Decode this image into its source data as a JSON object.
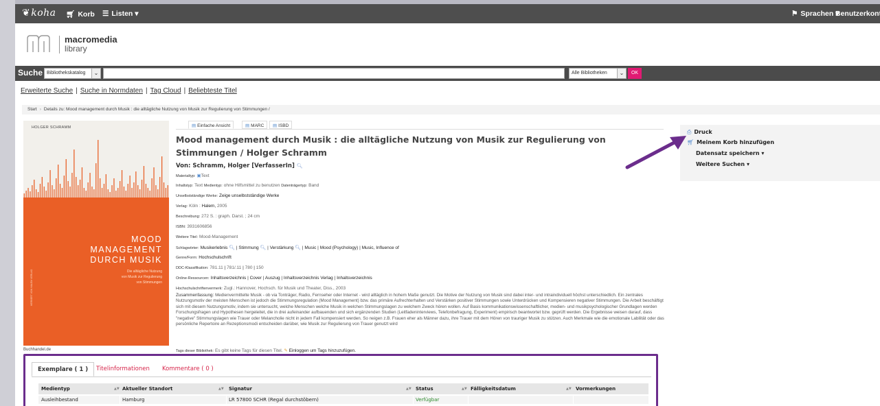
{
  "navbar": {
    "brand": "koha",
    "cart": "Korb",
    "lists": "Listen",
    "languages": "Sprachen",
    "account": "Benutzerkonto"
  },
  "logo": {
    "line1": "macromedia",
    "line2": "library"
  },
  "search": {
    "label": "Suche",
    "scope": "Bibliothekskatalog",
    "library": "Alle Bibliotheken",
    "ok": "OK"
  },
  "sublinks": [
    "Erweiterte Suche",
    "Suche in Normdaten",
    "Tag Cloud",
    "Beliebteste Titel"
  ],
  "breadcrumb": {
    "home": "Start",
    "current": "Details zu: Mood management durch Musik : die alltägliche Nutzung von Musik zur Regulierung von Stimmungen /"
  },
  "cover": {
    "author": "HOLGER SCHRAMM",
    "title_l1": "MOOD",
    "title_l2": "MANAGEMENT",
    "title_l3": "DURCH MUSIK",
    "sub_l1": "Die alltägliche Nutzung",
    "sub_l2": "von Musik zur Regulierung",
    "sub_l3": "von Stimmungen",
    "spine": "HERBERT VON HALEM VERLAG",
    "caption": "Buchhandel.de"
  },
  "viewtabs": [
    "Einfache Ansicht",
    "MARC",
    "ISBD"
  ],
  "record": {
    "title": "Mood management durch Musik : die alltägliche Nutzung von Musik zur Regulierung von Stimmungen / Holger Schramm",
    "author_label": "Von:",
    "author": "Schramm, Holger [VerfasserIn]",
    "material_label": "Materialtyp:",
    "material": "Text",
    "content_label": "Inhaltstyp:",
    "content": "Text",
    "media_label": "Medientyp:",
    "media": "ohne Hilfsmittel zu benutzen",
    "carrier_label": "Datenträgertyp:",
    "carrier": "Band",
    "independent_label": "Unselbstständige Werke:",
    "independent": "Zeige unselbstständige Werke",
    "publisher_label": "Verlag:",
    "publisher_place": "Köln :",
    "publisher": "Halem,",
    "publisher_year": "2005",
    "desc_label": "Beschreibung:",
    "desc": "272 S. : graph. Darst. ; 24 cm",
    "isbn_label": "ISBN:",
    "isbn": "3931606856",
    "other_title_label": "Weitere Titel:",
    "other_title": "Mood-Management",
    "subjects_label": "Schlagwörter:",
    "subjects": [
      "Musikerlebnis",
      "Stimmung",
      "Verstärkung",
      "Music",
      "Mood (Psychology)",
      "Music, Influence of"
    ],
    "genre_label": "Genre/Form:",
    "genre": "Hochschulschrift",
    "ddc_label": "DDC-Klassifikation:",
    "ddc": [
      "781.11",
      "781/.11",
      "780",
      "150"
    ],
    "online_label": "Online-Ressourcen:",
    "online": [
      "Inhaltsverzeichnis",
      "Cover",
      "Auszug",
      "Inhaltsverzeichnis Verlag",
      "Inhaltsverzeichnis"
    ],
    "thesis_label": "Hochschulschriftenvermerk:",
    "thesis": "Zugl.: Hannover, Hochsch. für Musik und Theater, Diss., 2003",
    "summary_label": "Zusammenfassung:",
    "summary": "Medienvermittelte Musik - ob via Tonträger, Radio, Fernseher oder Internet - wird alltäglich in hohem Maße genutzt. Die Motive der Nutzung von Musik sind dabei inter- und intraindividuell höchst unterschiedlich. Ein zentrales Nutzungsmotiv der meisten Menschen ist jedoch die Stimmungsregulation (Mood Management) bzw. das primäre Aufrechterhalten und Verstärken positiver Stimmungen sowie Unterdrücken und Kompensieren negativer Stimmungen. Die Arbeit beschäftigt sich mit diesem Nutzungsmotiv, indem sie untersucht, welche Menschen welche Musik in welchen Stimmungslagen zu welchem Zweck hören wollen. Auf Basis kommunikationswissenschaftlicher, medien- und musikpsychologischer Grundlagen werden Forschungsfragen und Hypothesen hergeleitet, die in drei aufeinander aufbauenden und sich ergänzenden Studien (Leitfadeninterviews, Telefonbefragung, Experiment) empirisch beantwortet bzw. geprüft werden. Die Ergebnisse weisen darauf, dass \"negative\" Stimmungslagen wie Trauer oder Melancholie nicht in jedem Fall kompensiert werden. So neigen z.B. Frauen eher als Männer dazu, ihre Trauer mit dem Hören von trauriger Musik zu stützen. Auch Merkmale wie die emotionale Labilität oder das persönliche Repertoire an Rezeptionsmodi entscheiden darüber, wie Musik zur Regulierung von Trauer genutzt wird",
    "tags_label": "Tags dieser Bibliothek:",
    "tags_none": "Es gibt keine Tags für diesen Titel.",
    "tags_login": "Einloggen um Tags hinzuzufügen."
  },
  "actions": {
    "print": "Druck",
    "add_cart": "Meinem Korb hinzufügen",
    "save": "Datensatz speichern",
    "more": "Weitere Suchen"
  },
  "holdings": {
    "tabs": [
      "Exemplare ( 1 )",
      "Titelinformationen",
      "Kommentare ( 0 )"
    ],
    "columns": [
      "Medientyp",
      "Aktueller Standort",
      "Signatur",
      "Status",
      "Fälligkeitsdatum",
      "Vormerkungen"
    ],
    "rows": [
      [
        "Ausleihbestand",
        "Hamburg",
        "LR 57800 SCHR (Regal durchstöbern)",
        "Verfügbar",
        "",
        ""
      ]
    ]
  },
  "colors": {
    "navbar": "#4e4e4e",
    "accent": "#e11a73",
    "annotation": "#6b2d8c",
    "cover_orange": "#ea5f26",
    "available": "#2d8a2d"
  }
}
